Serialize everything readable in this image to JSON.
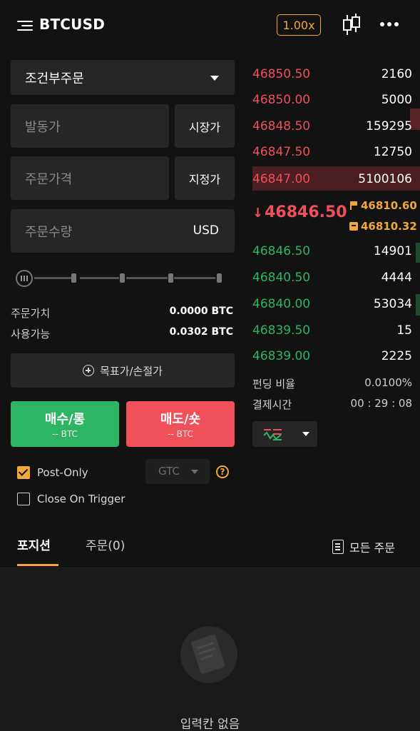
{
  "header": {
    "title": "BTCUSD",
    "leverage": "1.00x"
  },
  "form": {
    "order_type": "조건부주문",
    "trigger_price_placeholder": "발동가",
    "trigger_type_button": "시장가",
    "order_price_placeholder": "주문가격",
    "price_type_button": "지정가",
    "quantity_placeholder": "주문수량",
    "quantity_unit": "USD",
    "slider_value": 0,
    "order_value_label": "주문가치",
    "order_value": "0.0000 BTC",
    "available_label": "사용가능",
    "available": "0.0302 BTC",
    "tpsl_label": "목표가/손절가",
    "buy_label": "매수/롱",
    "buy_sub": "-- BTC",
    "sell_label": "매도/숏",
    "sell_sub": "-- BTC",
    "post_only_label": "Post-Only",
    "post_only_checked": true,
    "time_in_force": "GTC",
    "close_on_trigger_label": "Close On Trigger",
    "close_on_trigger_checked": false
  },
  "orderbook": {
    "asks": [
      {
        "price": "46850.50",
        "qty": "2160"
      },
      {
        "price": "46850.00",
        "qty": "5000"
      },
      {
        "price": "46848.50",
        "qty": "159295"
      },
      {
        "price": "46847.50",
        "qty": "12750"
      },
      {
        "price": "46847.00",
        "qty": "5100106"
      }
    ],
    "last_price": "46846.50",
    "mark_price": "46810.60",
    "index_price": "46810.32",
    "bids": [
      {
        "price": "46846.50",
        "qty": "14901"
      },
      {
        "price": "46840.50",
        "qty": "4444"
      },
      {
        "price": "46840.00",
        "qty": "53034"
      },
      {
        "price": "46839.50",
        "qty": "15"
      },
      {
        "price": "46839.00",
        "qty": "2225"
      }
    ],
    "funding_rate_label": "펀딩 비율",
    "funding_rate": "0.0100%",
    "settlement_label": "결제시간",
    "settlement_time": "00 : 29 : 08"
  },
  "tabs": {
    "positions": "포지션",
    "orders": "주문(0)",
    "all_orders": "모든 주문"
  },
  "empty": {
    "text": "입력칸 없음"
  },
  "colors": {
    "accent": "#f0a83a",
    "buy": "#2db564",
    "sell": "#f0505a",
    "background": "#121212",
    "panel": "#262626"
  }
}
